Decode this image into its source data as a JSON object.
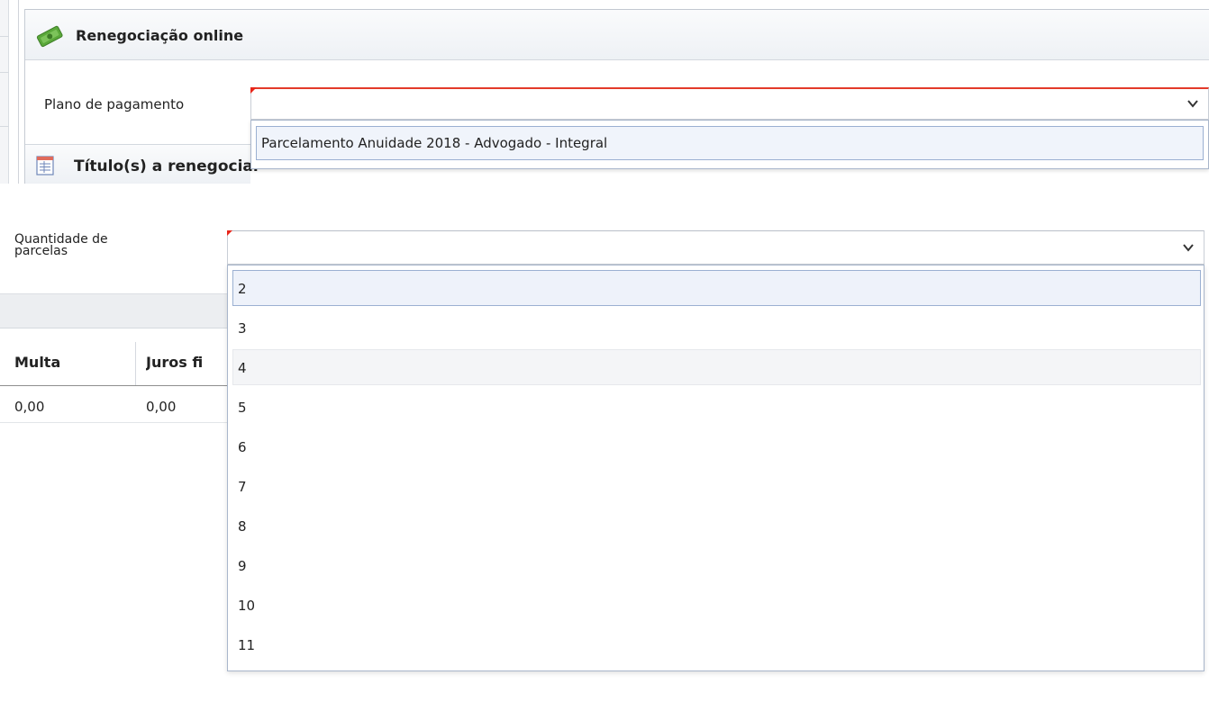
{
  "renegociacao": {
    "title": "Renegociação online",
    "icon": "money-icon"
  },
  "plano_pagamento": {
    "label": "Plano de pagamento",
    "value": "",
    "options": [
      "Parcelamento Anuidade 2018 - Advogado - Integral"
    ]
  },
  "titulos": {
    "title": "Título(s) a renegociar",
    "icon": "spreadsheet-icon"
  },
  "quantidade_parcelas": {
    "label_line1": "Quantidade de",
    "label_line2": "parcelas",
    "value": "",
    "options": [
      "2",
      "3",
      "4",
      "5",
      "6",
      "7",
      "8",
      "9",
      "10",
      "11"
    ]
  },
  "table": {
    "columns": [
      "Multa",
      "Juros fi"
    ],
    "rows": [
      [
        "0,00",
        "0,00"
      ]
    ]
  },
  "colors": {
    "required_marker": "#e8261a",
    "selected_bg": "#eef2fa",
    "selected_border": "#9bb0d2"
  }
}
